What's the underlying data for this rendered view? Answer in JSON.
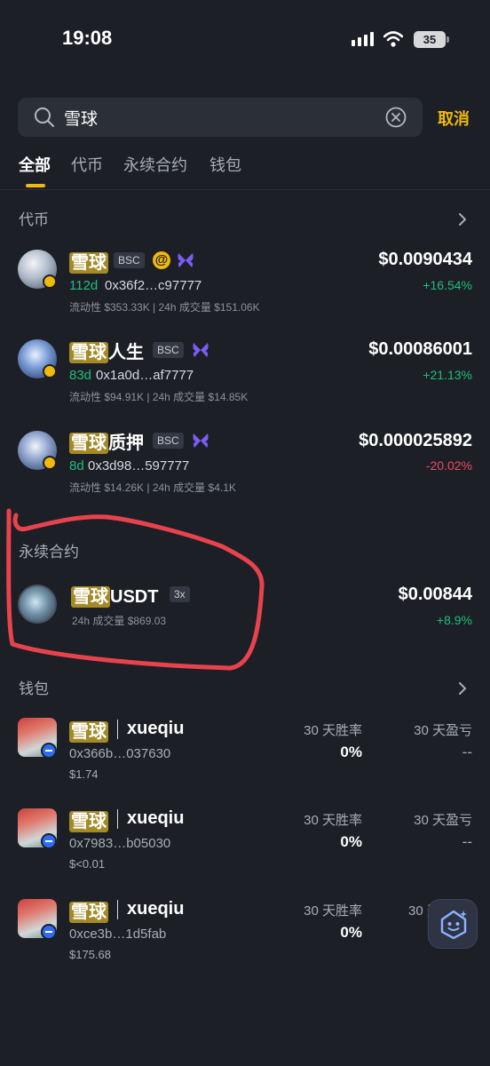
{
  "status": {
    "time": "19:08",
    "battery": "35"
  },
  "search": {
    "query": "雪球",
    "cancel": "取消"
  },
  "tabs": [
    "全部",
    "代币",
    "永续合约",
    "钱包"
  ],
  "sections": {
    "tokens": "代币",
    "perps": "永续合约",
    "wallets": "钱包"
  },
  "tokens": [
    {
      "hl": "雪球",
      "rest": "",
      "chain": "BSC",
      "age": "112d",
      "address": "0x36f2…c97777",
      "meta": "流动性 $353.33K | 24h 成交量 $151.06K",
      "price": "$0.0090434",
      "change": "+16.54%"
    },
    {
      "hl": "雪球",
      "rest": "人生",
      "chain": "BSC",
      "age": "83d",
      "address": "0x1a0d…af7777",
      "meta": "流动性 $94.91K | 24h 成交量 $14.85K",
      "price": "$0.00086001",
      "change": "+21.13%"
    },
    {
      "hl": "雪球",
      "rest": "质押",
      "chain": "BSC",
      "age": "8d",
      "address": "0x3d98…597777",
      "meta": "流动性 $14.26K | 24h 成交量 $4.1K",
      "price": "$0.000025892",
      "change": "-20.02%"
    }
  ],
  "perp": {
    "hl": "雪球",
    "rest": "USDT",
    "leverage": "3x",
    "volume": "24h 成交量 $869.03",
    "price": "$0.00844",
    "change": "+8.9%"
  },
  "wallets": [
    {
      "hl": "雪球",
      "name": "xueqiu",
      "address": "0x366b…037630",
      "balance": "$1.74",
      "winrate_label": "30 天胜率",
      "winrate": "0%",
      "pnl_label": "30 天盈亏",
      "pnl": "--"
    },
    {
      "hl": "雪球",
      "name": "xueqiu",
      "address": "0x7983…b05030",
      "balance": "$<0.01",
      "winrate_label": "30 天胜率",
      "winrate": "0%",
      "pnl_label": "30 天盈亏",
      "pnl": "--"
    },
    {
      "hl": "雪球",
      "name": "xueqiu",
      "address": "0xce3b…1d5fab",
      "balance": "$175.68",
      "winrate_label": "30 天胜率",
      "winrate": "0%",
      "pnl_label": "30 天盈亏",
      "pnl": ""
    }
  ],
  "colors": {
    "accent": "#f0b90b",
    "up": "#1fbf7a",
    "down": "#f2495e",
    "highlight": "#a38a26",
    "annotation": "#e8434c"
  }
}
